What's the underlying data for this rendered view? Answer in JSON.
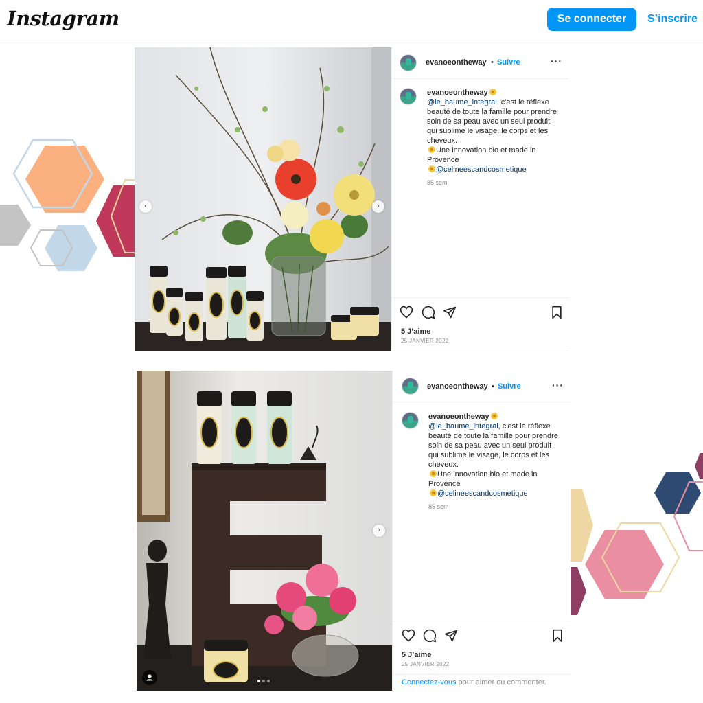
{
  "header": {
    "logo": "Instagram",
    "login_label": "Se connecter",
    "signup_label": "S’inscrire"
  },
  "colors": {
    "accent": "#0095f6",
    "hex_orange": "#fbb07f",
    "hex_crimson": "#c0395a",
    "hex_gray": "#c4c4c4",
    "hex_lightblue": "#c2d7e8",
    "hex_navy": "#2f4a72",
    "hex_pink": "#ea8fa1",
    "hex_beige": "#efd7a3",
    "hex_plum": "#8e3d64"
  },
  "posts": [
    {
      "username": "evanoeontheway",
      "separator": "•",
      "follow_label": "Suivre",
      "more_icon": "more-dots-icon",
      "caption": {
        "username": "evanoeontheway",
        "mention_1": "@le_baume_integral",
        "text_1": ", c'est le réflexe beauté de toute la famille pour prendre soin de sa peau avec un seul produit qui sublime le visage, le corps et les cheveux.",
        "text_2": "Une innovation bio et made in Provence",
        "mention_2": "@celineescandcosmetique"
      },
      "time_ago": "85 sem",
      "likes": "5 J’aime",
      "date": "25 JANVIER 2022"
    },
    {
      "username": "evanoeontheway",
      "separator": "•",
      "follow_label": "Suivre",
      "more_icon": "more-dots-icon",
      "caption": {
        "username": "evanoeontheway",
        "mention_1": "@le_baume_integral",
        "text_1": ", c'est le réflexe beauté de toute la famille pour prendre soin de sa peau avec un seul produit qui sublime le visage, le corps et les cheveux.",
        "text_2": "Une innovation bio et made in Provence",
        "mention_2": "@celineescandcosmetique"
      },
      "time_ago": "85 sem",
      "likes": "5 J’aime",
      "date": "25 JANVIER 2022",
      "login_link": "Connectez-vous",
      "login_suffix": " pour aimer ou commenter."
    }
  ],
  "icons": [
    "heart-icon",
    "comment-icon",
    "share-icon",
    "bookmark-icon",
    "chevron-left-icon",
    "chevron-right-icon",
    "user-tag-icon",
    "sun-emoji-icon"
  ]
}
